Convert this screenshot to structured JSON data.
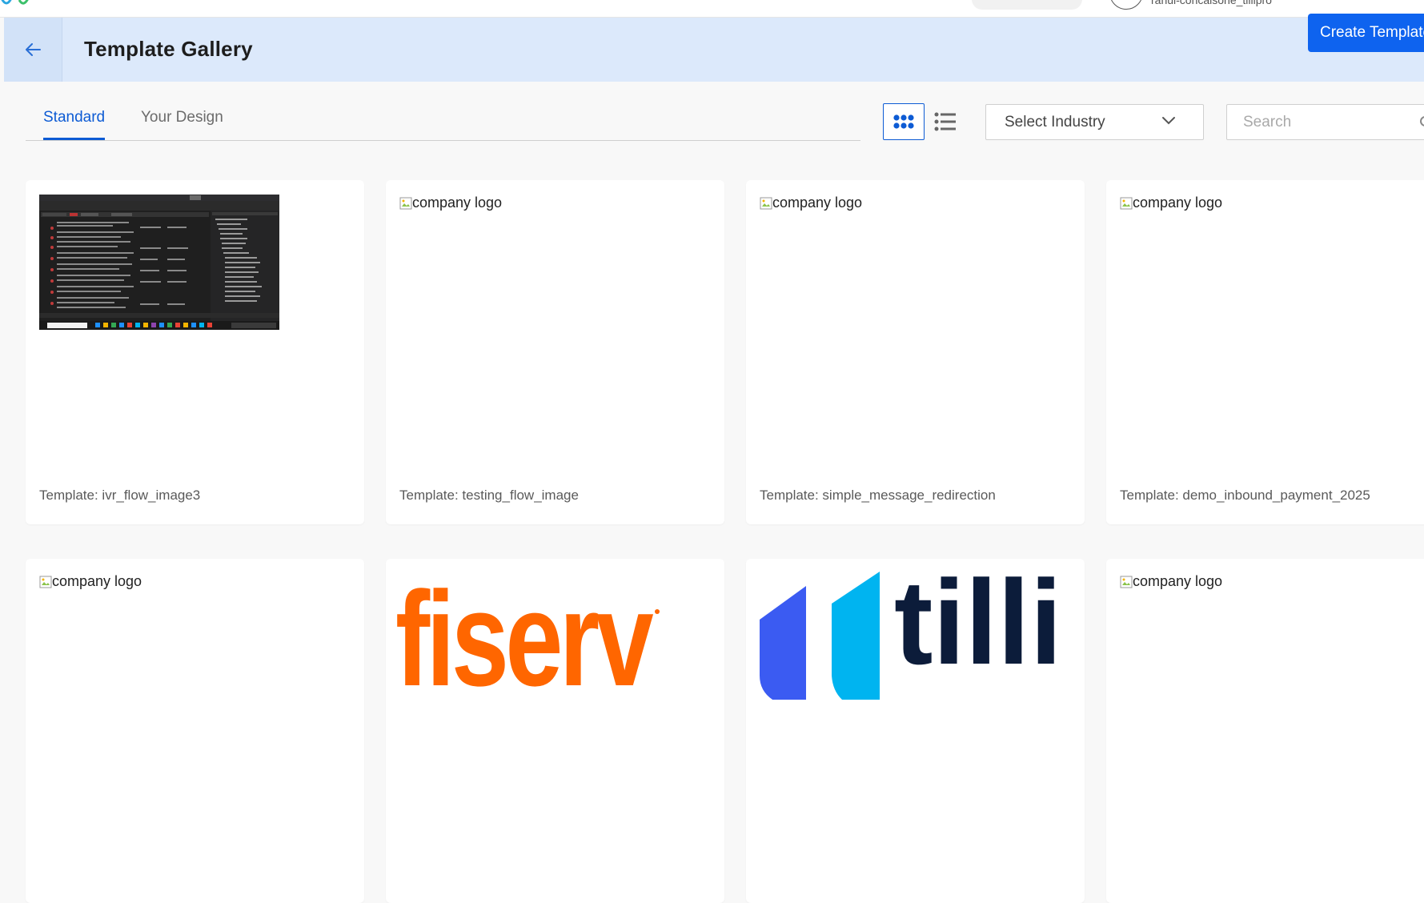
{
  "topbar": {
    "user_text": "rahul-concalsone_tillipro"
  },
  "header": {
    "title": "Template Gallery",
    "create_button": "Create Template"
  },
  "tabs": [
    {
      "label": "Standard",
      "active": true
    },
    {
      "label": "Your Design",
      "active": false
    }
  ],
  "toolbar": {
    "industry_select": "Select Industry",
    "search_placeholder": "Search"
  },
  "templates": [
    {
      "caption": "Template: ivr_flow_image3",
      "image": "screenshot-thumbnail"
    },
    {
      "caption": "Template: testing_flow_image",
      "image_alt": "company logo"
    },
    {
      "caption": "Template: simple_message_redirection",
      "image_alt": "company logo"
    },
    {
      "caption": "Template: demo_inbound_payment_2025",
      "image_alt": "company logo"
    }
  ],
  "templates_row2": [
    {
      "image_alt": "company logo"
    },
    {
      "logo_text": "fiserv",
      "logo_color": "#ff6600"
    },
    {
      "logo_text": "tilli",
      "logo_color": "#0c1c3a",
      "mark_colors": [
        "#3b5bf2",
        "#00b4f0"
      ]
    },
    {
      "image_alt": "company logo"
    }
  ],
  "colors": {
    "accent": "#0d5bd4",
    "header_bg": "#dce9fb",
    "create_button_bg": "#0e63ef",
    "page_bg": "#f8f8f8"
  },
  "icons": {
    "back": "arrow-left-icon",
    "grid_view": "grid-view-icon",
    "list_view": "list-view-icon",
    "dropdown": "chevron-down-icon",
    "search": "search-icon",
    "broken_image": "broken-image-icon"
  }
}
